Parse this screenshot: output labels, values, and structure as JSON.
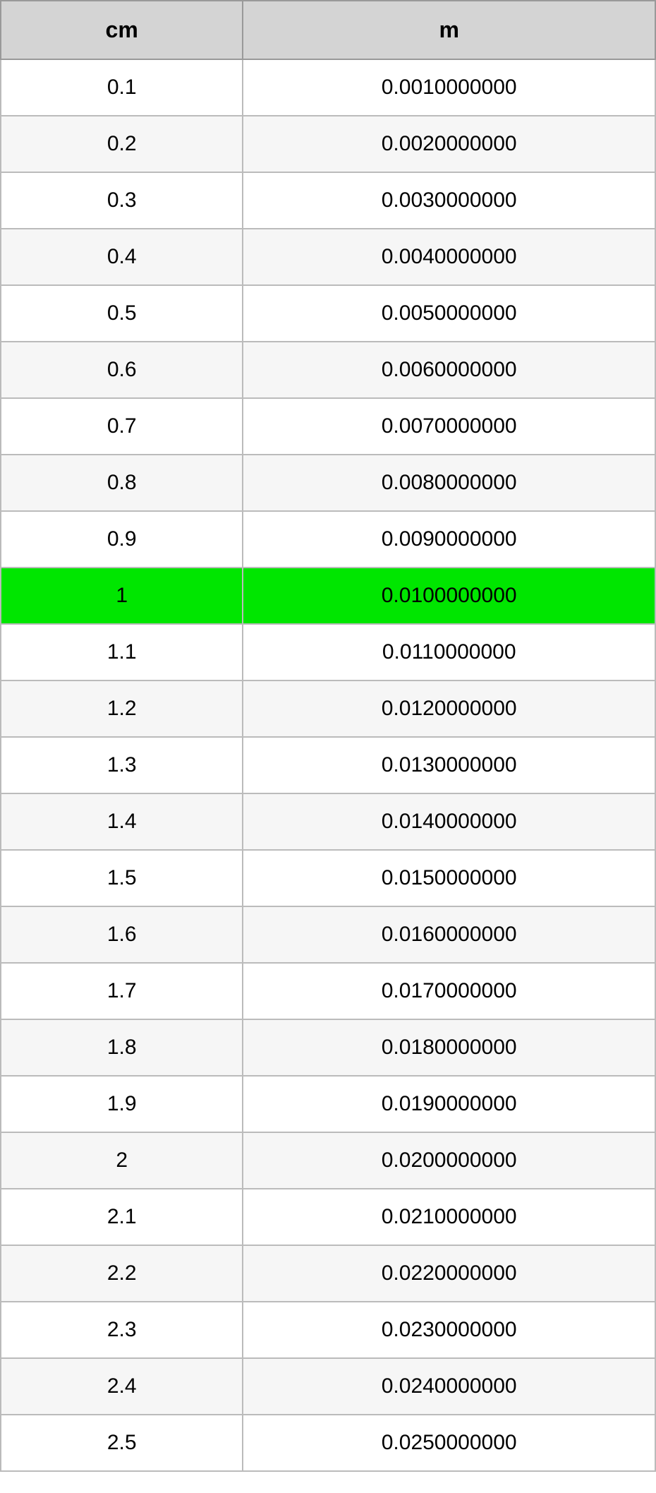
{
  "headers": {
    "col1": "cm",
    "col2": "m"
  },
  "rows": [
    {
      "cm": "0.1",
      "m": "0.0010000000",
      "highlight": false
    },
    {
      "cm": "0.2",
      "m": "0.0020000000",
      "highlight": false
    },
    {
      "cm": "0.3",
      "m": "0.0030000000",
      "highlight": false
    },
    {
      "cm": "0.4",
      "m": "0.0040000000",
      "highlight": false
    },
    {
      "cm": "0.5",
      "m": "0.0050000000",
      "highlight": false
    },
    {
      "cm": "0.6",
      "m": "0.0060000000",
      "highlight": false
    },
    {
      "cm": "0.7",
      "m": "0.0070000000",
      "highlight": false
    },
    {
      "cm": "0.8",
      "m": "0.0080000000",
      "highlight": false
    },
    {
      "cm": "0.9",
      "m": "0.0090000000",
      "highlight": false
    },
    {
      "cm": "1",
      "m": "0.0100000000",
      "highlight": true
    },
    {
      "cm": "1.1",
      "m": "0.0110000000",
      "highlight": false
    },
    {
      "cm": "1.2",
      "m": "0.0120000000",
      "highlight": false
    },
    {
      "cm": "1.3",
      "m": "0.0130000000",
      "highlight": false
    },
    {
      "cm": "1.4",
      "m": "0.0140000000",
      "highlight": false
    },
    {
      "cm": "1.5",
      "m": "0.0150000000",
      "highlight": false
    },
    {
      "cm": "1.6",
      "m": "0.0160000000",
      "highlight": false
    },
    {
      "cm": "1.7",
      "m": "0.0170000000",
      "highlight": false
    },
    {
      "cm": "1.8",
      "m": "0.0180000000",
      "highlight": false
    },
    {
      "cm": "1.9",
      "m": "0.0190000000",
      "highlight": false
    },
    {
      "cm": "2",
      "m": "0.0200000000",
      "highlight": false
    },
    {
      "cm": "2.1",
      "m": "0.0210000000",
      "highlight": false
    },
    {
      "cm": "2.2",
      "m": "0.0220000000",
      "highlight": false
    },
    {
      "cm": "2.3",
      "m": "0.0230000000",
      "highlight": false
    },
    {
      "cm": "2.4",
      "m": "0.0240000000",
      "highlight": false
    },
    {
      "cm": "2.5",
      "m": "0.0250000000",
      "highlight": false
    }
  ]
}
